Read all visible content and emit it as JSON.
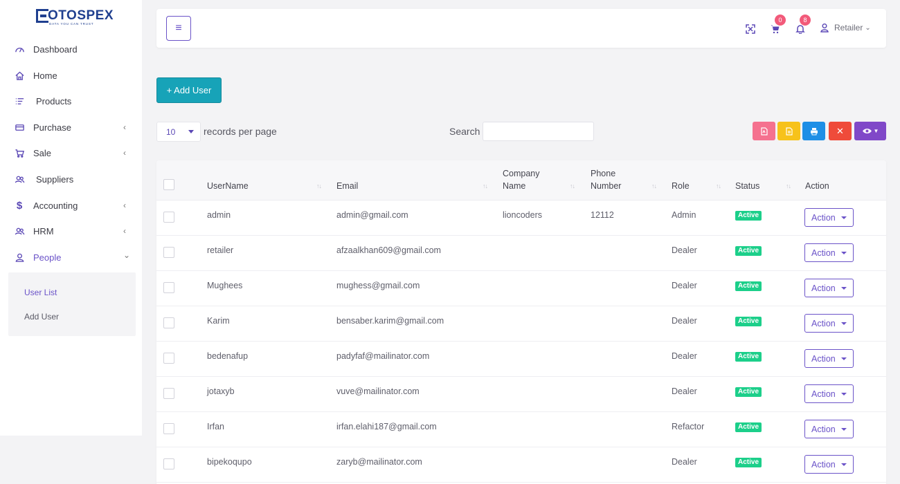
{
  "brand": {
    "name": "OTOSPEX",
    "tagline": "DATA YOU CAN TRUST"
  },
  "colors": {
    "accent": "#6a52c8",
    "primary_btn": "#17a3b8",
    "active_badge": "#1ccf8a",
    "notify_badge": "#f25a7a"
  },
  "sidebar": {
    "items": [
      {
        "label": "Dashboard",
        "icon": "gauge-icon",
        "chevron": ""
      },
      {
        "label": "Home",
        "icon": "home-icon",
        "chevron": ""
      },
      {
        "label": "Products",
        "icon": "list-icon",
        "chevron": ""
      },
      {
        "label": "Purchase",
        "icon": "card-icon",
        "chevron": "‹"
      },
      {
        "label": "Sale",
        "icon": "cart-icon",
        "chevron": "‹"
      },
      {
        "label": "Suppliers",
        "icon": "users-icon",
        "chevron": ""
      },
      {
        "label": "Accounting",
        "icon": "dollar-icon",
        "chevron": "‹"
      },
      {
        "label": "HRM",
        "icon": "users-icon",
        "chevron": "‹"
      },
      {
        "label": "People",
        "icon": "user-icon",
        "chevron": "⌄"
      }
    ],
    "submenu": [
      "User List",
      "Add User"
    ]
  },
  "header": {
    "cart_count": "0",
    "notification_count": "8",
    "user_label": "Retailer"
  },
  "toolbar": {
    "add_user_label": "+ Add User",
    "per_page_value": "10",
    "per_page_label": "records per page",
    "search_label": "Search",
    "search_value": ""
  },
  "table": {
    "columns": {
      "username": "UserName",
      "email": "Email",
      "company_1": "Company",
      "company_2": "Name",
      "phone_1": "Phone",
      "phone_2": "Number",
      "role": "Role",
      "status": "Status",
      "action": "Action"
    },
    "sort_glyph": "↑↓",
    "rows": [
      {
        "username": "admin",
        "email": "admin@gmail.com",
        "company": "lioncoders",
        "phone": "12112",
        "role": "Admin",
        "status": "Active",
        "action": "Action"
      },
      {
        "username": "retailer",
        "email": "afzaalkhan609@gmail.com",
        "company": "",
        "phone": "",
        "role": "Dealer",
        "status": "Active",
        "action": "Action"
      },
      {
        "username": "Mughees",
        "email": "mughess@gmail.com",
        "company": "",
        "phone": "",
        "role": "Dealer",
        "status": "Active",
        "action": "Action"
      },
      {
        "username": "Karim",
        "email": "bensaber.karim@gmail.com",
        "company": "",
        "phone": "",
        "role": "Dealer",
        "status": "Active",
        "action": "Action"
      },
      {
        "username": "bedenafup",
        "email": "padyfaf@mailinator.com",
        "company": "",
        "phone": "",
        "role": "Dealer",
        "status": "Active",
        "action": "Action"
      },
      {
        "username": "jotaxyb",
        "email": "vuve@mailinator.com",
        "company": "",
        "phone": "",
        "role": "Dealer",
        "status": "Active",
        "action": "Action"
      },
      {
        "username": "Irfan",
        "email": "irfan.elahi187@gmail.com",
        "company": "",
        "phone": "",
        "role": "Refactor",
        "status": "Active",
        "action": "Action"
      },
      {
        "username": "bipekoqupo",
        "email": "zaryb@mailinator.com",
        "company": "",
        "phone": "",
        "role": "Dealer",
        "status": "Active",
        "action": "Action"
      }
    ]
  }
}
